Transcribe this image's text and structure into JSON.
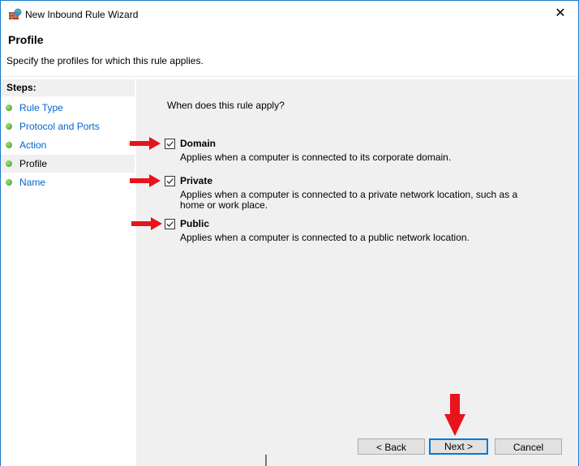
{
  "window": {
    "title": "New Inbound Rule Wizard",
    "close_icon": "close-icon"
  },
  "header": {
    "title": "Profile",
    "subtitle": "Specify the profiles for which this rule applies."
  },
  "steps": {
    "heading": "Steps:",
    "items": [
      {
        "label": "Rule Type",
        "current": false
      },
      {
        "label": "Protocol and Ports",
        "current": false
      },
      {
        "label": "Action",
        "current": false
      },
      {
        "label": "Profile",
        "current": true
      },
      {
        "label": "Name",
        "current": false
      }
    ]
  },
  "main": {
    "question": "When does this rule apply?",
    "options": [
      {
        "label": "Domain",
        "checked": true,
        "description": "Applies when a computer is connected to its corporate domain."
      },
      {
        "label": "Private",
        "checked": true,
        "description": "Applies when a computer is connected to a private network location, such as a home or work place."
      },
      {
        "label": "Public",
        "checked": true,
        "description": "Applies when a computer is connected to a public network location."
      }
    ]
  },
  "buttons": {
    "back": "< Back",
    "next": "Next >",
    "cancel": "Cancel"
  },
  "colors": {
    "annotation_arrow": "#e8141b",
    "link": "#0066cc",
    "focus": "#0078d7"
  }
}
